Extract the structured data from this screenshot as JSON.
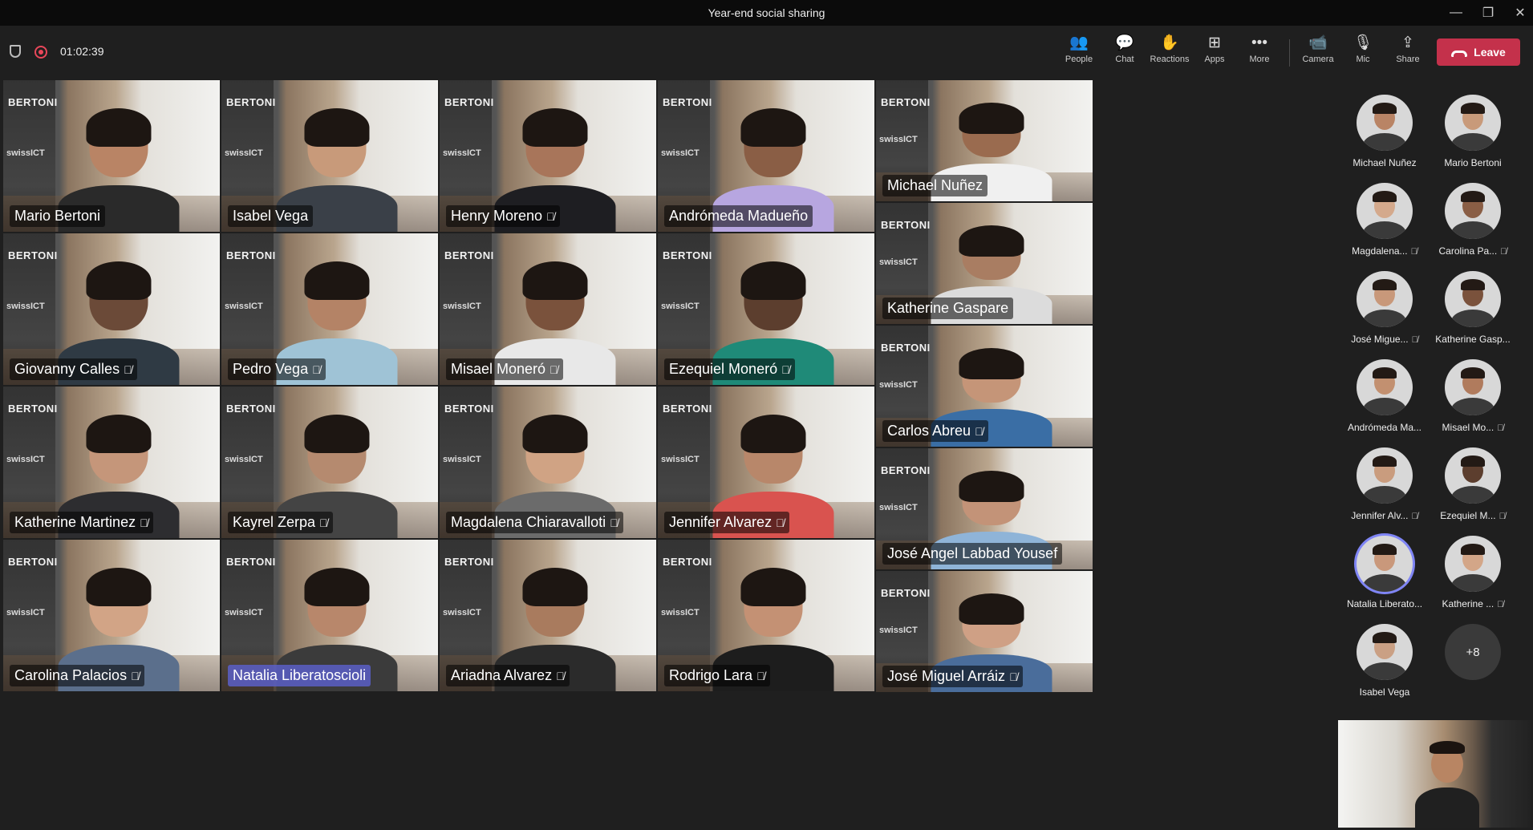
{
  "window": {
    "title": "Year-end social sharing",
    "controls": [
      "minimize",
      "restore",
      "close"
    ]
  },
  "meeting": {
    "timer": "01:02:39"
  },
  "toolbar": {
    "buttons": [
      {
        "label": "People",
        "icon": "people-icon"
      },
      {
        "label": "Chat",
        "icon": "chat-icon"
      },
      {
        "label": "Reactions",
        "icon": "reactions-icon"
      },
      {
        "label": "Apps",
        "icon": "apps-icon"
      },
      {
        "label": "More",
        "icon": "more-icon"
      },
      {
        "label": "Camera",
        "icon": "camera-icon"
      },
      {
        "label": "Mic",
        "icon": "mic-icon"
      },
      {
        "label": "Share",
        "icon": "share-icon"
      }
    ],
    "leave_label": "Leave"
  },
  "grid": {
    "brand": "BERTONI",
    "subbrand": "swissICT",
    "tiles": [
      {
        "name": "Mario Bertoni",
        "muted": false
      },
      {
        "name": "Isabel Vega",
        "muted": false
      },
      {
        "name": "Henry Moreno",
        "muted": true
      },
      {
        "name": "Andrómeda Madueño",
        "muted": false
      },
      {
        "name": "Michael Nuñez",
        "muted": false
      },
      {
        "name": "Giovanny Calles",
        "muted": true
      },
      {
        "name": "Pedro Vega",
        "muted": true
      },
      {
        "name": "Misael  Moneró",
        "muted": true
      },
      {
        "name": "Ezequiel Moneró",
        "muted": true
      },
      {
        "name": "Katherine Gaspare",
        "muted": false
      },
      {
        "name": "Katherine Martinez",
        "muted": true
      },
      {
        "name": "Kayrel Zerpa",
        "muted": true
      },
      {
        "name": "Magdalena Chiaravalloti",
        "muted": true
      },
      {
        "name": "Jennifer  Alvarez",
        "muted": true
      },
      {
        "name": "Carlos Abreu",
        "muted": true
      },
      {
        "name": "José Angel Labbad Yousef",
        "muted": false
      },
      {
        "name": "Carolina Palacios",
        "muted": true
      },
      {
        "name": "Natalia Liberatoscioli",
        "muted": false,
        "highlighted": true
      },
      {
        "name": "Ariadna Alvarez",
        "muted": true
      },
      {
        "name": "Rodrigo Lara",
        "muted": true
      },
      {
        "name": "José Miguel Arráiz",
        "muted": true
      }
    ]
  },
  "roster": {
    "people": [
      {
        "name": "Michael Nuñez",
        "muted": false
      },
      {
        "name": "Mario Bertoni",
        "muted": false
      },
      {
        "name": "Magdalena...",
        "muted": true
      },
      {
        "name": "Carolina Pa...",
        "muted": true
      },
      {
        "name": "José Migue...",
        "muted": true
      },
      {
        "name": "Katherine Gasp...",
        "muted": false
      },
      {
        "name": "Andrómeda Ma...",
        "muted": false
      },
      {
        "name": "Misael Mo...",
        "muted": true
      },
      {
        "name": "Jennifer Alv...",
        "muted": true
      },
      {
        "name": "Ezequiel M...",
        "muted": true
      },
      {
        "name": "Natalia Liberato...",
        "muted": false,
        "speaking": true
      },
      {
        "name": "Katherine ...",
        "muted": true
      },
      {
        "name": "Isabel Vega",
        "muted": false
      }
    ],
    "overflow_label": "+8"
  },
  "colors": {
    "leave": "#c4314b",
    "speaking_ring": "#7f85f5",
    "highlight_name": "#5b5fc7"
  }
}
